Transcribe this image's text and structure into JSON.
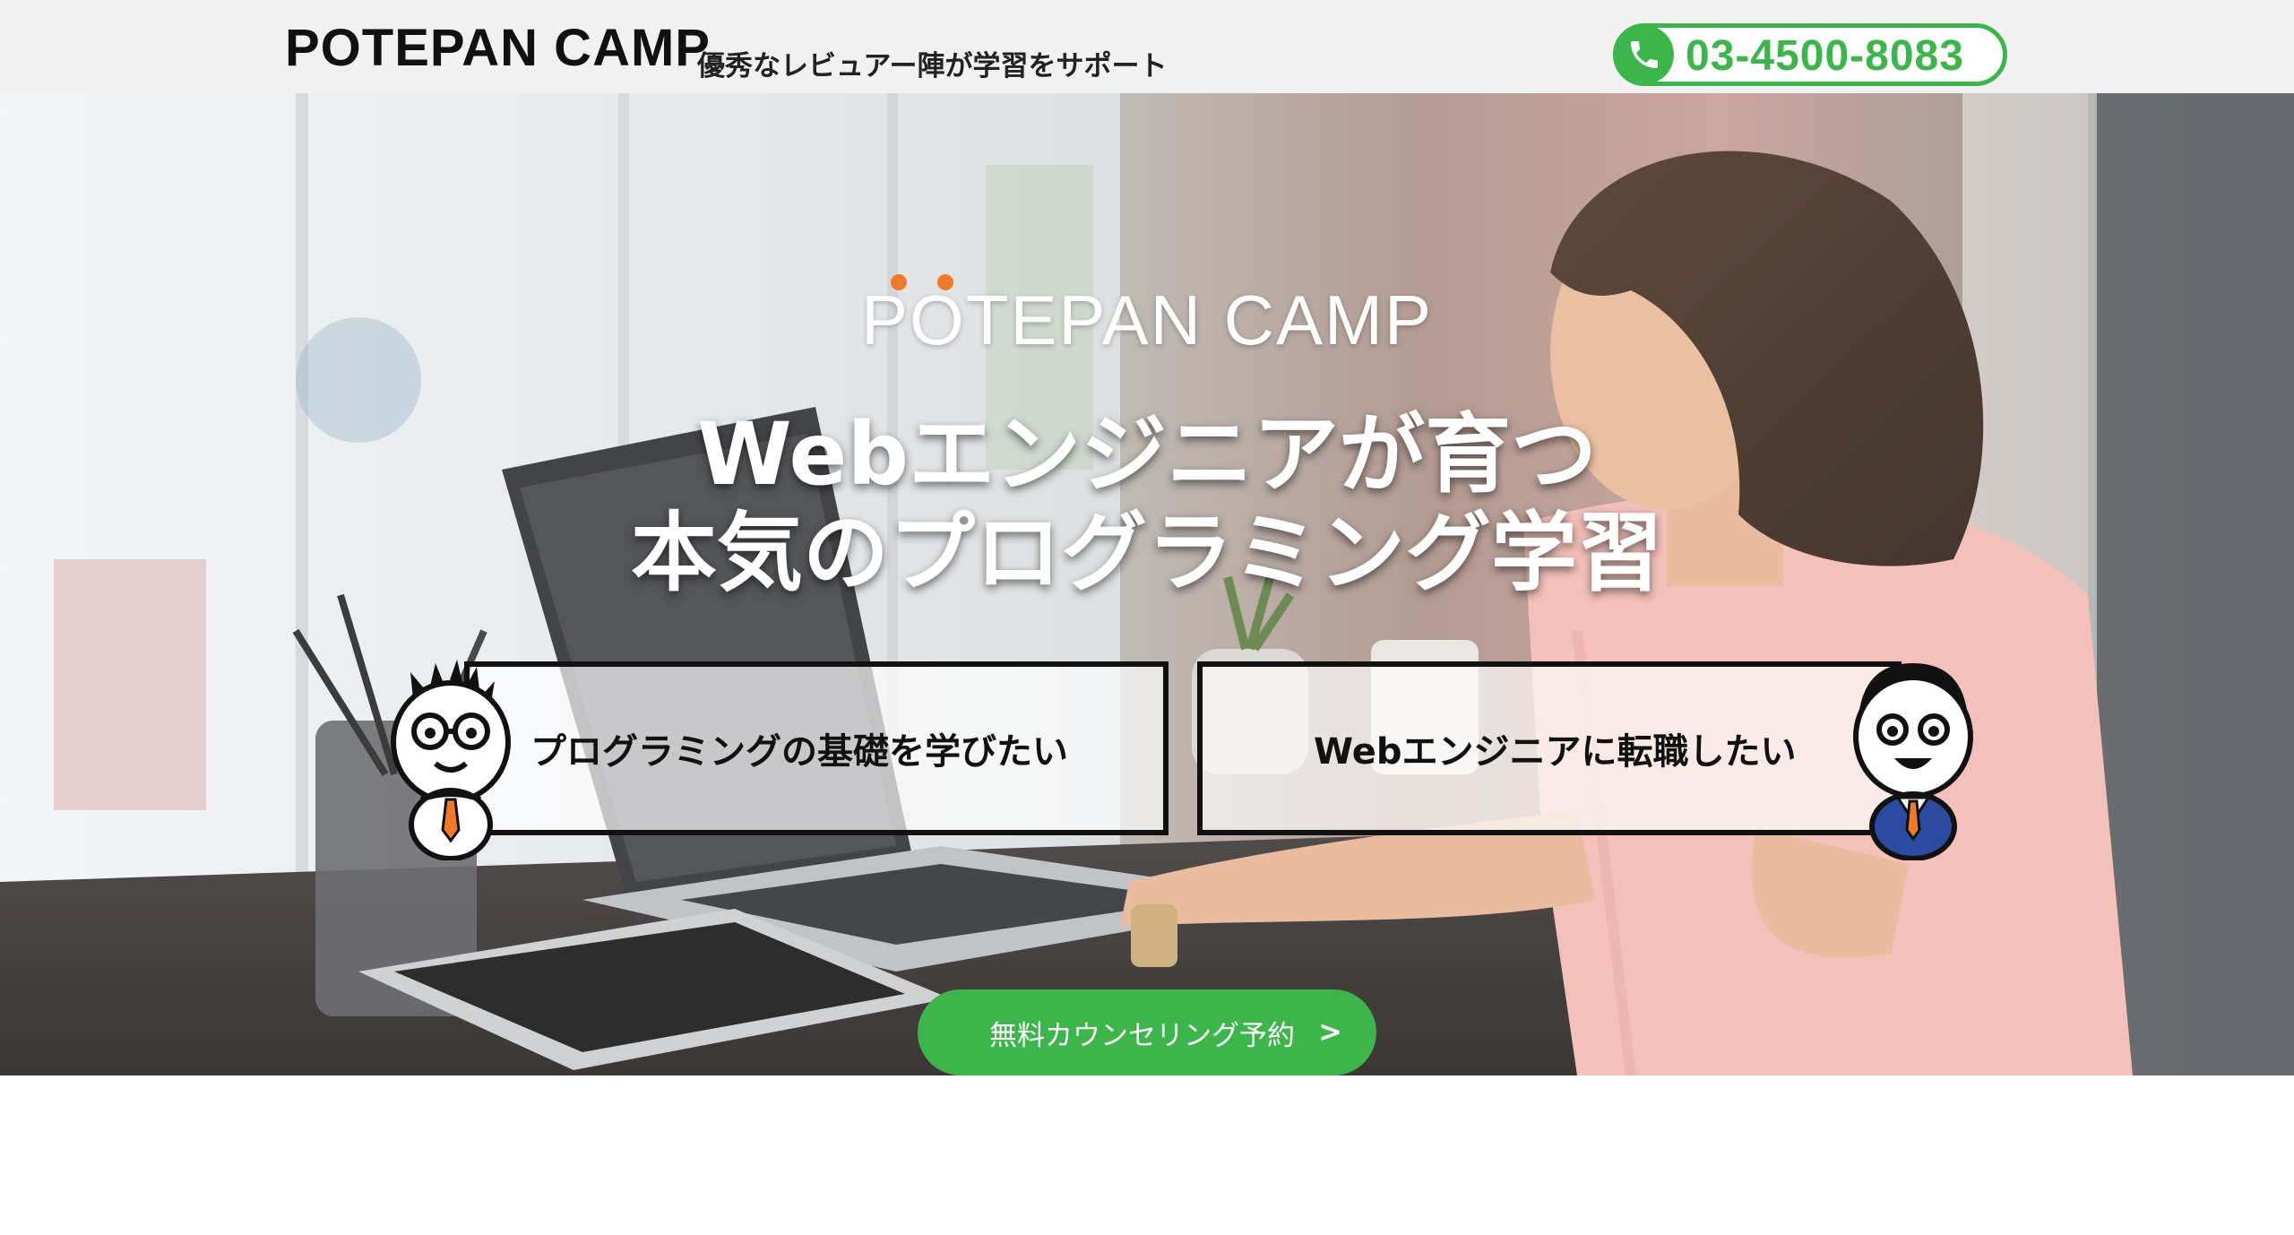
{
  "header": {
    "logo_text": "POTEPAN CAMP",
    "tagline": "優秀なレビュアー陣が学習をサポート",
    "phone_icon": "phone-icon",
    "phone_number": "03-4500-8083"
  },
  "hero": {
    "logo_text": "POTEPAN CAMP",
    "headline_line1": "Webエンジニアが育つ",
    "headline_line2": "本気のプログラミング学習",
    "choices": [
      {
        "label": "プログラミングの基礎を学びたい",
        "mascot": "glasses-mascot-icon"
      },
      {
        "label": "Webエンジニアに転職したい",
        "mascot": "suit-mascot-icon"
      }
    ],
    "cta_label": "無料カウンセリング予約",
    "cta_arrow": ">"
  },
  "colors": {
    "brand_green": "#3cb54a",
    "accent_orange": "#ef7b2a",
    "header_bg": "#f1f1f1"
  }
}
